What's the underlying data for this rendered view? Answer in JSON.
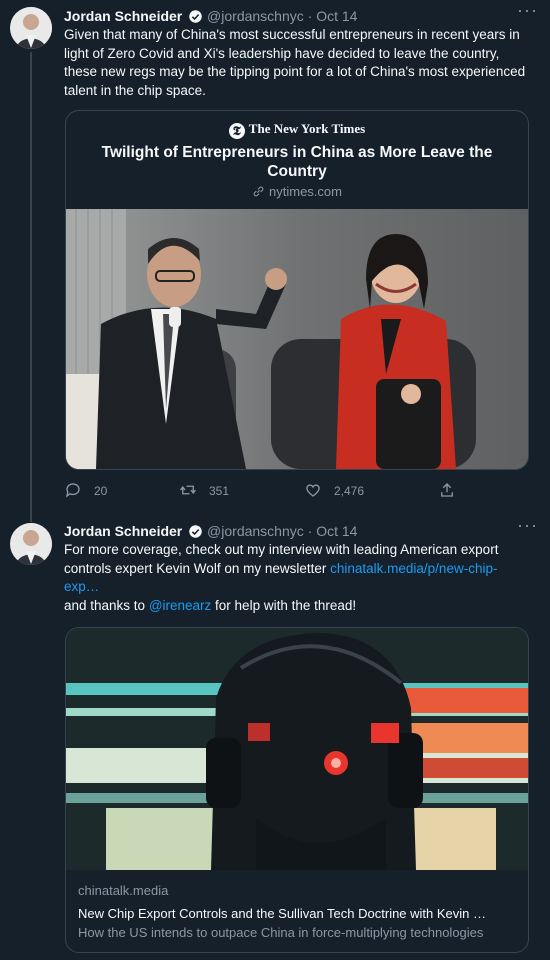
{
  "tweets": [
    {
      "author_name": "Jordan Schneider",
      "handle": "@jordanschnyc",
      "separator": "·",
      "date": "Oct 14",
      "text": "Given that many of China's most successful entrepreneurs in recent years in light of Zero Covid and Xi's leadership have decided to leave the country, these new regs may be the tipping point for a lot of China's most experienced talent in the chip space.",
      "card": {
        "publisher": "The New York Times",
        "publisher_glyph": "𝕿",
        "title": "Twilight of Entrepreneurs in China as More Leave the Country",
        "domain": "nytimes.com"
      },
      "replies": "20",
      "retweets": "351",
      "likes": "2,476"
    },
    {
      "author_name": "Jordan Schneider",
      "handle": "@jordanschnyc",
      "separator": "·",
      "date": "Oct 14",
      "text_prefix": "For more coverage, check out my interview with leading American export controls expert Kevin Wolf on my newsletter ",
      "link_text": "chinatalk.media/p/new-chip-exp…",
      "line2_prefix": "and thanks to ",
      "mention": "@irenearz",
      "line2_suffix": " for help with the thread!",
      "card": {
        "domain": "chinatalk.media",
        "title": "New Chip Export Controls and the Sullivan Tech Doctrine with Kevin …",
        "description": "How the US intends to outpace China in force-multiplying technologies"
      }
    }
  ],
  "colors": {
    "background": "#15202b",
    "text_primary": "#f7f9f9",
    "text_secondary": "#8b98a5",
    "link": "#1d9bf0",
    "border": "#38444d"
  },
  "icons": [
    "verified-badge-icon",
    "more-options-icon",
    "reply-icon",
    "retweet-icon",
    "like-icon",
    "share-icon",
    "link-icon"
  ]
}
